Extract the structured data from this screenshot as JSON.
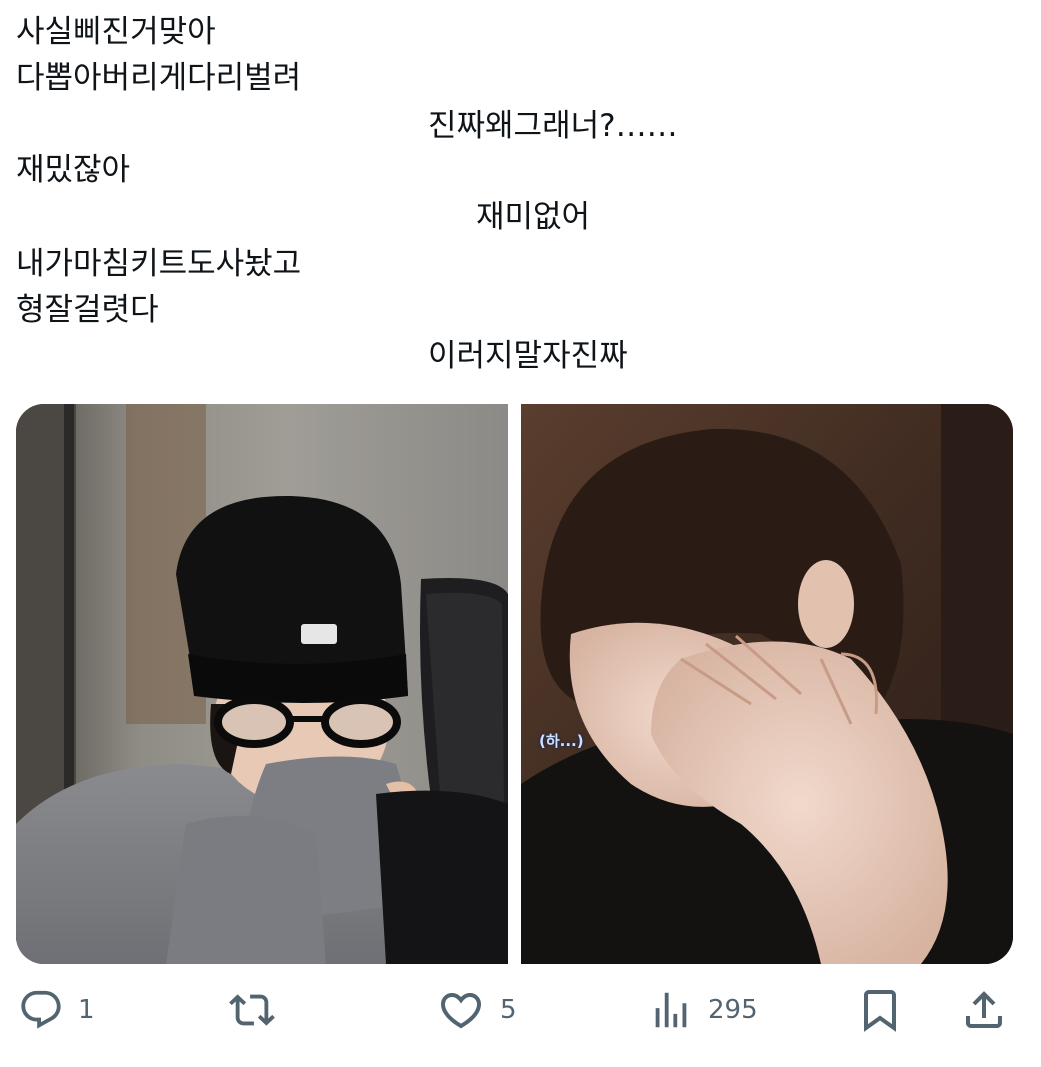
{
  "tweet": {
    "clipped_top_text": "",
    "lines": [
      {
        "text": "사실삐진거맞아"
      },
      {
        "text": "다뽑아버리게다리벌려"
      },
      {
        "text": "진짜왜그래너?……"
      },
      {
        "text": "재밌잖아"
      },
      {
        "text": "재미없어"
      },
      {
        "text": "내가마침키트도사놨고"
      },
      {
        "text": "형잘걸렷다"
      },
      {
        "text": "이러지말자진짜"
      }
    ]
  },
  "media": {
    "right_caption": "(하...)"
  },
  "actions": {
    "reply": {
      "icon": "reply-icon",
      "count": "1"
    },
    "retweet": {
      "icon": "retweet-icon",
      "count": ""
    },
    "like": {
      "icon": "heart-icon",
      "count": "5"
    },
    "views": {
      "icon": "views-icon",
      "count": "295"
    },
    "bookmark": {
      "icon": "bookmark-icon"
    },
    "share": {
      "icon": "share-icon"
    }
  },
  "colors": {
    "text": "#0f1419",
    "secondary": "#536471",
    "background": "#ffffff"
  }
}
